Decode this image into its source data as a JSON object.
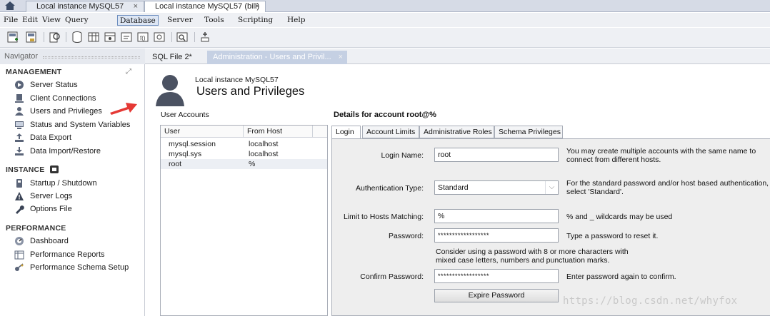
{
  "app_tabs": [
    {
      "label": "Local instance MySQL57",
      "close": "×"
    },
    {
      "label": "Local instance MySQL57 (bill)",
      "close": "×"
    }
  ],
  "menu": [
    "File",
    "Edit",
    "View",
    "Query",
    "Database",
    "Server",
    "Tools",
    "Scripting",
    "Help"
  ],
  "menu_selected": "Database",
  "navigator": {
    "title": "Navigator",
    "management": {
      "label": "MANAGEMENT",
      "items": [
        "Server Status",
        "Client Connections",
        "Users and Privileges",
        "Status and System Variables",
        "Data Export",
        "Data Import/Restore"
      ]
    },
    "instance": {
      "label": "INSTANCE",
      "items": [
        "Startup / Shutdown",
        "Server Logs",
        "Options File"
      ]
    },
    "performance": {
      "label": "PERFORMANCE",
      "items": [
        "Dashboard",
        "Performance Reports",
        "Performance Schema Setup"
      ]
    }
  },
  "editor_tabs": [
    {
      "label": "SQL File 2*"
    },
    {
      "label": "Administration - Users and Privil...",
      "close": "×"
    }
  ],
  "header": {
    "subtitle": "Local instance MySQL57",
    "title": "Users and Privileges"
  },
  "accounts": {
    "label": "User Accounts",
    "columns": [
      "User",
      "From Host"
    ],
    "rows": [
      {
        "user": "mysql.session",
        "host": "localhost"
      },
      {
        "user": "mysql.sys",
        "host": "localhost"
      },
      {
        "user": "root",
        "host": "%"
      }
    ]
  },
  "details": {
    "title": "Details for account root@%",
    "tabs": [
      "Login",
      "Account Limits",
      "Administrative Roles",
      "Schema Privileges"
    ],
    "login": {
      "login_name_label": "Login Name:",
      "login_name_value": "root",
      "login_name_hint": "You may create multiple accounts with the same name to connect from different hosts.",
      "auth_type_label": "Authentication Type:",
      "auth_type_value": "Standard",
      "auth_type_hint": "For the standard password and/or host based authentication, select 'Standard'.",
      "hosts_label": "Limit to Hosts Matching:",
      "hosts_value": "%",
      "hosts_hint": "% and _ wildcards may be used",
      "password_label": "Password:",
      "password_value": "******************",
      "password_hint": "Type a password to reset it.",
      "password_advice": "Consider using a password with 8 or more characters with mixed case letters, numbers and punctuation marks.",
      "confirm_label": "Confirm Password:",
      "confirm_value": "******************",
      "confirm_hint": "Enter password again to confirm.",
      "expire_button": "Expire Password"
    }
  },
  "watermark": "https://blog.csdn.net/whyfox",
  "colors": {
    "active_tab": "#c5d0e3",
    "panel_bg": "#eeeeee",
    "arrow": "#e53935"
  }
}
